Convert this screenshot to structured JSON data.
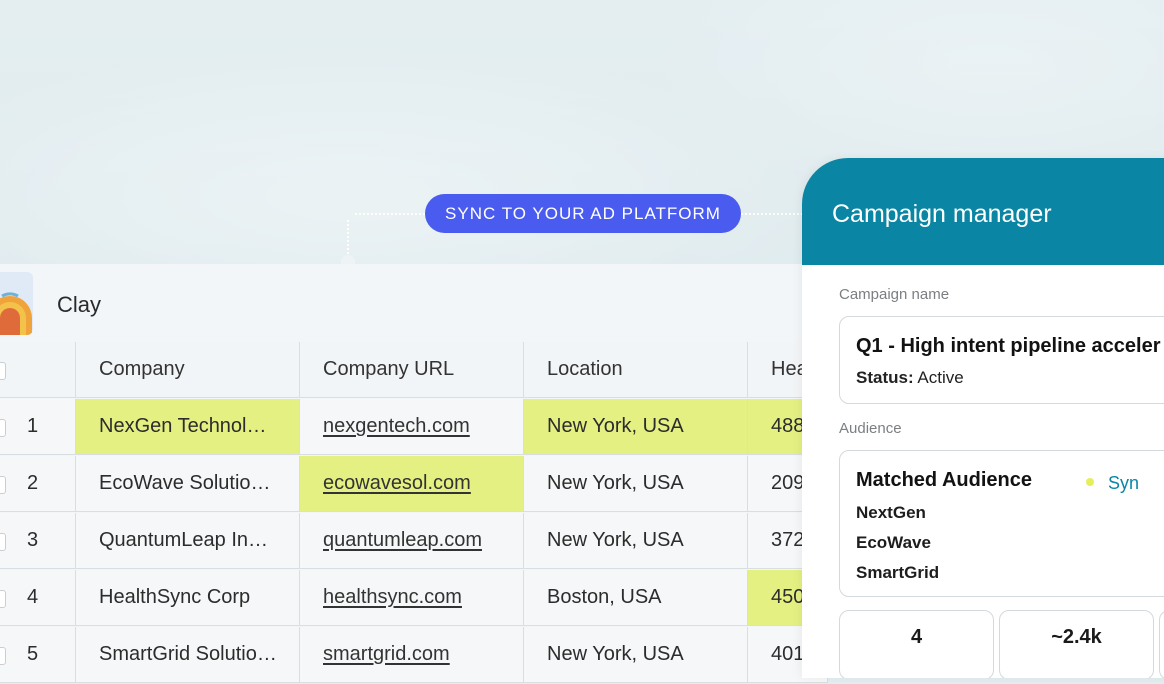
{
  "sync_button": {
    "label": "SYNC TO YOUR AD PLATFORM"
  },
  "clay": {
    "title": "Clay",
    "columns": [
      "Company",
      "Company URL",
      "Location",
      "Hea"
    ],
    "rows": [
      {
        "num": "1",
        "company": "NexGen Technol…",
        "url": "nexgentech.com",
        "location": "New York, USA",
        "head": "488"
      },
      {
        "num": "2",
        "company": "EcoWave Solutio…",
        "url": "ecowavesol.com",
        "location": "New York, USA",
        "head": "209"
      },
      {
        "num": "3",
        "company": "QuantumLeap In…",
        "url": "quantumleap.com",
        "location": "New York, USA",
        "head": "372"
      },
      {
        "num": "4",
        "company": "HealthSync Corp",
        "url": "healthsync.com",
        "location": "Boston, USA",
        "head": "450"
      },
      {
        "num": "5",
        "company": "SmartGrid Solutio…",
        "url": "smartgrid.com",
        "location": "New York, USA",
        "head": "401"
      }
    ]
  },
  "campaign": {
    "title": "Campaign manager",
    "name_label": "Campaign name",
    "name_value": "Q1 - High intent pipeline acceler",
    "status_key": "Status:",
    "status_value": "Active",
    "audience_label": "Audience",
    "audience_title": "Matched Audience",
    "sync_status": "Syn",
    "audience_items": [
      "NextGen",
      "EcoWave",
      "SmartGrid"
    ],
    "stats": [
      "4",
      "~2.4k"
    ]
  },
  "colors": {
    "sync_pill": "#4a5cf0",
    "campaign_header": "#0a86a4",
    "highlight": "#e4f082"
  }
}
